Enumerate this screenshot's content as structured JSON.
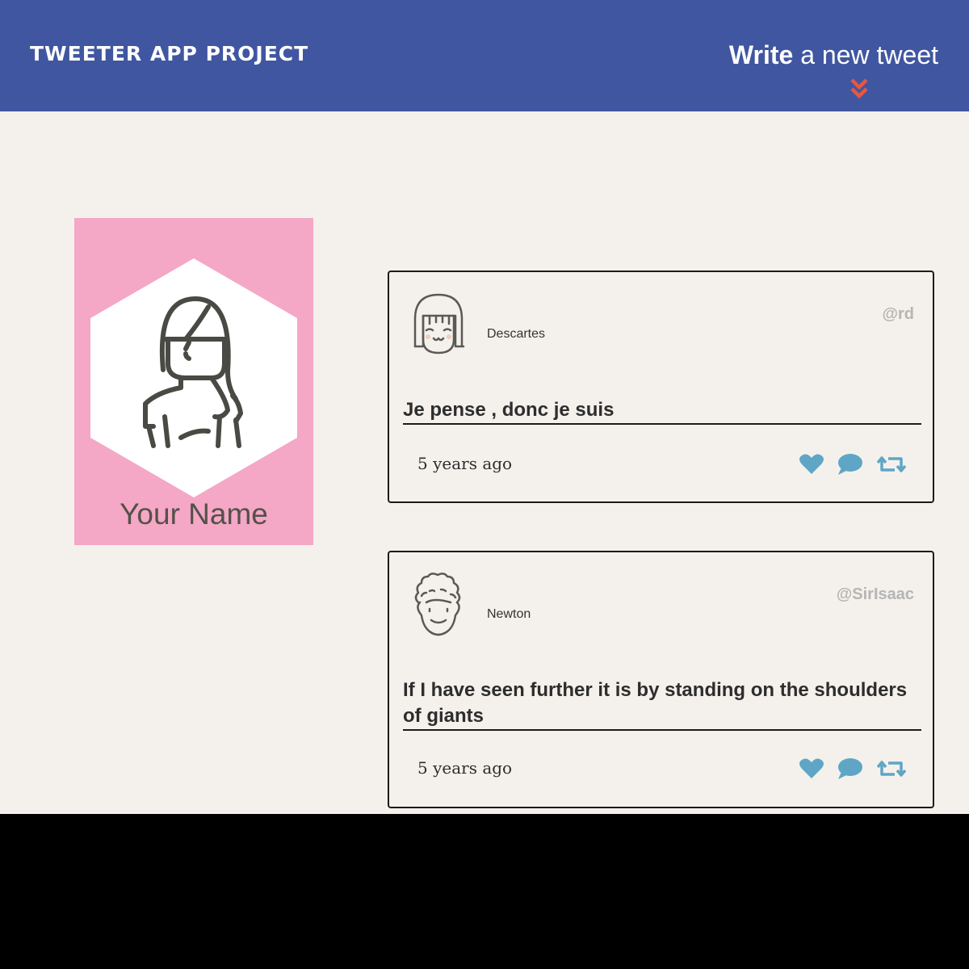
{
  "header": {
    "brand": "TWEETER APP PROJECT",
    "compose_bold": "Write",
    "compose_rest": " a new tweet",
    "accent_color": "#e8573f",
    "bar_color": "#4056a1"
  },
  "profile": {
    "name": "Your Name",
    "card_color": "#f5a7c6"
  },
  "tweets": [
    {
      "author": "Descartes",
      "handle": "@rd",
      "content": "Je pense , donc je suis",
      "time": "5 years ago",
      "icons": [
        "heart-icon",
        "comment-icon",
        "retweet-icon"
      ]
    },
    {
      "author": "Newton",
      "handle": "@SirIsaac",
      "content": "If I have seen further it is by standing on the shoulders of giants",
      "time": "5 years ago",
      "icons": [
        "heart-icon",
        "comment-icon",
        "retweet-icon"
      ]
    }
  ],
  "colors": {
    "icon": "#5fa6c6",
    "page_bg": "#f4f1ec"
  }
}
